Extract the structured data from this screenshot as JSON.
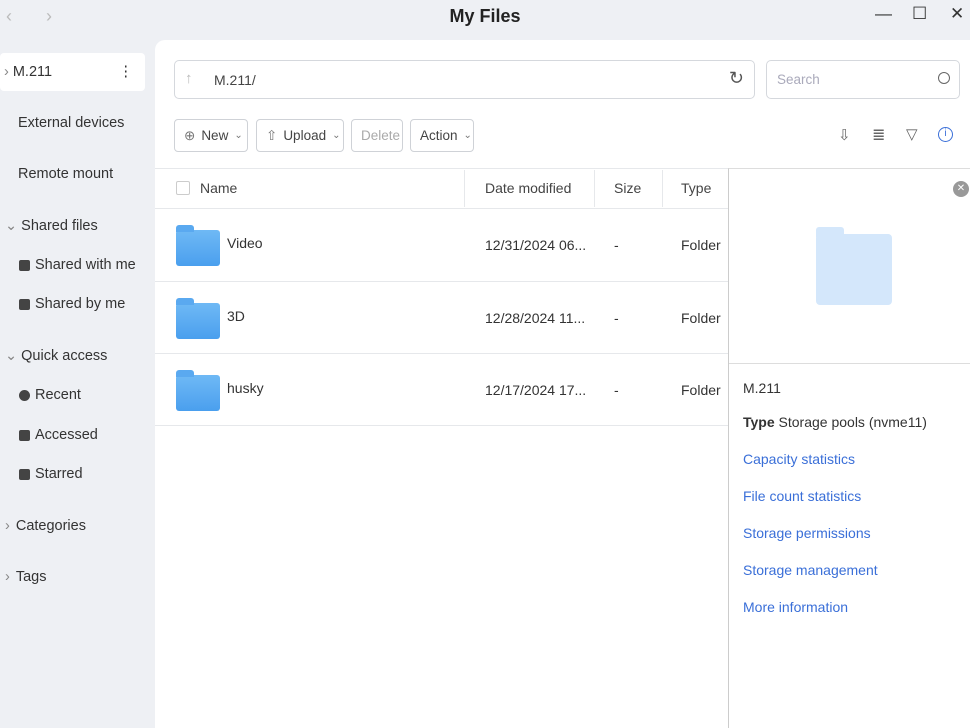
{
  "window": {
    "title": "My Files",
    "back": "‹",
    "forward": "›",
    "minimize": "—",
    "maximize": "☐",
    "close": "✕"
  },
  "sidebar": {
    "root": {
      "label": "M.211",
      "more": "⋮"
    },
    "items": [
      {
        "label": "External devices"
      },
      {
        "label": "Remote mount"
      },
      {
        "label": "Shared files"
      },
      {
        "label": "Shared with me"
      },
      {
        "label": "Shared by me"
      },
      {
        "label": "Quick access"
      },
      {
        "label": "Recent"
      },
      {
        "label": "Accessed"
      },
      {
        "label": "Starred"
      },
      {
        "label": "Categories"
      },
      {
        "label": "Tags"
      }
    ]
  },
  "path": {
    "value": "M.211/"
  },
  "search": {
    "placeholder": "Search"
  },
  "toolbar": {
    "new": "New",
    "upload": "Upload",
    "delete": "Delete",
    "action": "Action"
  },
  "table": {
    "headers": {
      "name": "Name",
      "date": "Date modified",
      "size": "Size",
      "type": "Type"
    },
    "rows": [
      {
        "name": "Video",
        "date": "12/31/2024 06...",
        "size": "-",
        "type": "Folder"
      },
      {
        "name": "3D",
        "date": "12/28/2024 11...",
        "size": "-",
        "type": "Folder"
      },
      {
        "name": "husky",
        "date": "12/17/2024 17...",
        "size": "-",
        "type": "Folder"
      }
    ]
  },
  "details": {
    "name": "M.211",
    "type_label": "Type",
    "type_value": "Storage pools (nvme11)",
    "links": [
      "Capacity statistics",
      "File count statistics",
      "Storage permissions",
      "Storage management",
      "More information"
    ]
  },
  "colors": {
    "accent": "#3a6fd8",
    "folder": "#5aa9f0"
  }
}
